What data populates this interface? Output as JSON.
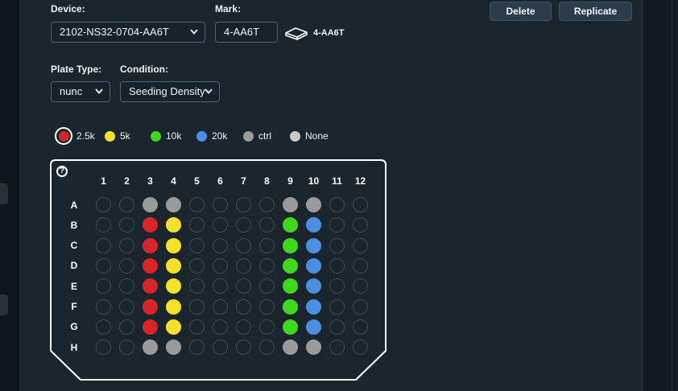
{
  "form": {
    "device_label": "Device:",
    "device_value": "2102-NS32-0704-AA6T",
    "mark_label": "Mark:",
    "mark_value": "4-AA6T",
    "mark_chip_text": "4-AA6T",
    "plate_type_label": "Plate Type:",
    "plate_type_value": "nunc",
    "condition_label": "Condition:",
    "condition_value": "Seeding Density"
  },
  "actions": {
    "delete_label": "Delete",
    "replicate_label": "Replicate"
  },
  "legend": [
    {
      "key": "r",
      "label": "2.5k",
      "color": "#d8252a",
      "selected": true
    },
    {
      "key": "y",
      "label": "5k",
      "color": "#f5e12b",
      "selected": false
    },
    {
      "key": "g",
      "label": "10k",
      "color": "#3fd81a",
      "selected": false
    },
    {
      "key": "b",
      "label": "20k",
      "color": "#4a8fe0",
      "selected": false
    },
    {
      "key": "c",
      "label": "ctrl",
      "color": "#9a9a9a",
      "selected": false
    },
    {
      "key": "n",
      "label": "None",
      "color": "#c9c9c9",
      "selected": false
    }
  ],
  "plate": {
    "help_text": "?",
    "columns": [
      "1",
      "2",
      "3",
      "4",
      "5",
      "6",
      "7",
      "8",
      "9",
      "10",
      "11",
      "12"
    ],
    "rows": [
      "A",
      "B",
      "C",
      "D",
      "E",
      "F",
      "G",
      "H"
    ],
    "wells": [
      [
        "",
        "",
        "c",
        "c",
        "",
        "",
        "",
        "",
        "c",
        "c",
        "",
        ""
      ],
      [
        "",
        "",
        "r",
        "y",
        "",
        "",
        "",
        "",
        "g",
        "b",
        "",
        ""
      ],
      [
        "",
        "",
        "r",
        "y",
        "",
        "",
        "",
        "",
        "g",
        "b",
        "",
        ""
      ],
      [
        "",
        "",
        "r",
        "y",
        "",
        "",
        "",
        "",
        "g",
        "b",
        "",
        ""
      ],
      [
        "",
        "",
        "r",
        "y",
        "",
        "",
        "",
        "",
        "g",
        "b",
        "",
        ""
      ],
      [
        "",
        "",
        "r",
        "y",
        "",
        "",
        "",
        "",
        "g",
        "b",
        "",
        ""
      ],
      [
        "",
        "",
        "r",
        "y",
        "",
        "",
        "",
        "",
        "g",
        "b",
        "",
        ""
      ],
      [
        "",
        "",
        "c",
        "c",
        "",
        "",
        "",
        "",
        "c",
        "c",
        "",
        ""
      ]
    ]
  }
}
